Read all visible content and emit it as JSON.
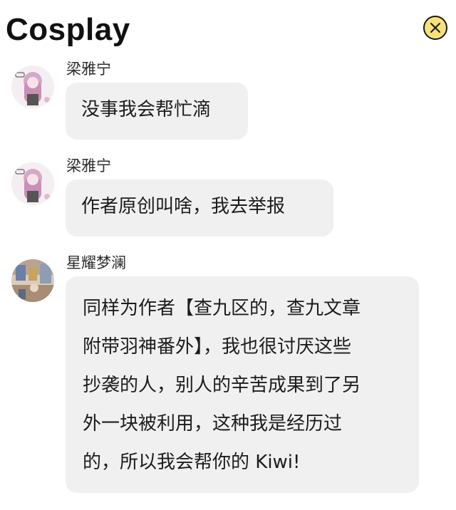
{
  "header": {
    "title": "Cosplay",
    "close_icon": "close-icon",
    "close_color": "#f7e27a"
  },
  "messages": [
    {
      "sender": "梁雅宁",
      "avatar_icon": "anime-girl-avatar",
      "text": "没事我会帮忙滴"
    },
    {
      "sender": "梁雅宁",
      "avatar_icon": "anime-girl-avatar",
      "text": "作者原创叫啥，我去举报"
    },
    {
      "sender": "星耀梦澜",
      "avatar_icon": "room-scene-avatar",
      "lines": [
        "同样为作者【查九区的，查九文章",
        "附带羽神番外】，我也很讨厌这些",
        "抄袭的人，别人的辛苦成果到了另",
        "外一块被利用，这种我是经历过",
        "的，所以我会帮你的 Kiwi!"
      ]
    }
  ],
  "colors": {
    "bubble_bg": "#f0f0f0",
    "page_bg": "#ffffff"
  }
}
